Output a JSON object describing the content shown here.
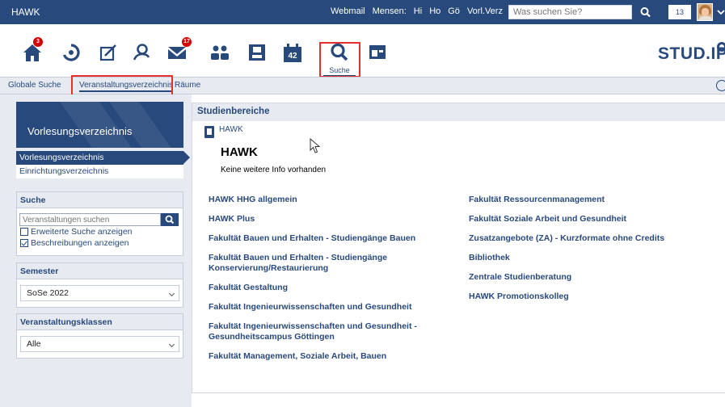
{
  "topbar": {
    "app_name": "HAWK",
    "links": [
      "Webmail",
      "Mensen:",
      "Hi",
      "Ho",
      "Gö",
      "Vorl.Verz"
    ],
    "search_placeholder": "Was suchen Sie?",
    "counter": "13"
  },
  "iconnav": {
    "home_badge": "3",
    "messages_badge": "17",
    "schedule_number": "42",
    "search_label": "Suche",
    "logo": "STUD.IP"
  },
  "tabs": [
    "Globale Suche",
    "Veranstaltungsverzeichnis",
    "Räume"
  ],
  "sidebar": {
    "header": "Vorlesungsverzeichnis",
    "nav": [
      "Vorlesungsverzeichnis",
      "Einrichtungsverzeichnis"
    ],
    "search": {
      "title": "Suche",
      "placeholder": "Veranstaltungen suchen",
      "extended": "Erweiterte Suche anzeigen",
      "descriptions": "Beschreibungen anzeigen"
    },
    "semester": {
      "title": "Semester",
      "value": "SoSe 2022"
    },
    "klassen": {
      "title": "Veranstaltungsklassen",
      "value": "Alle"
    }
  },
  "main": {
    "title": "Studienbereiche",
    "crumb": "HAWK",
    "heading": "HAWK",
    "info": "Keine weitere Info vorhanden",
    "col1": [
      "HAWK HHG allgemein",
      "HAWK Plus",
      "Fakultät Bauen und Erhalten - Studiengänge Bauen",
      "Fakultät Bauen und Erhalten - Studiengänge Konservierung/Restaurierung",
      "Fakultät Gestaltung",
      "Fakultät Ingenieurwissenschaften und Gesundheit",
      "Fakultät Ingenieurwissenschaften und Gesundheit - Gesundheitscampus Göttingen",
      "Fakultät Management, Soziale Arbeit, Bauen"
    ],
    "col2": [
      "Fakultät Ressourcenmanagement",
      "Fakultät Soziale Arbeit und Gesundheit",
      "Zusatzangebote (ZA) - Kurzformate ohne Credits",
      "Bibliothek",
      "Zentrale Studienberatung",
      "HAWK Promotionskolleg"
    ]
  },
  "colors": {
    "brand": "#28497c",
    "highlight": "#e4302f",
    "badge": "#d60000",
    "panel": "#e7ebf1"
  }
}
